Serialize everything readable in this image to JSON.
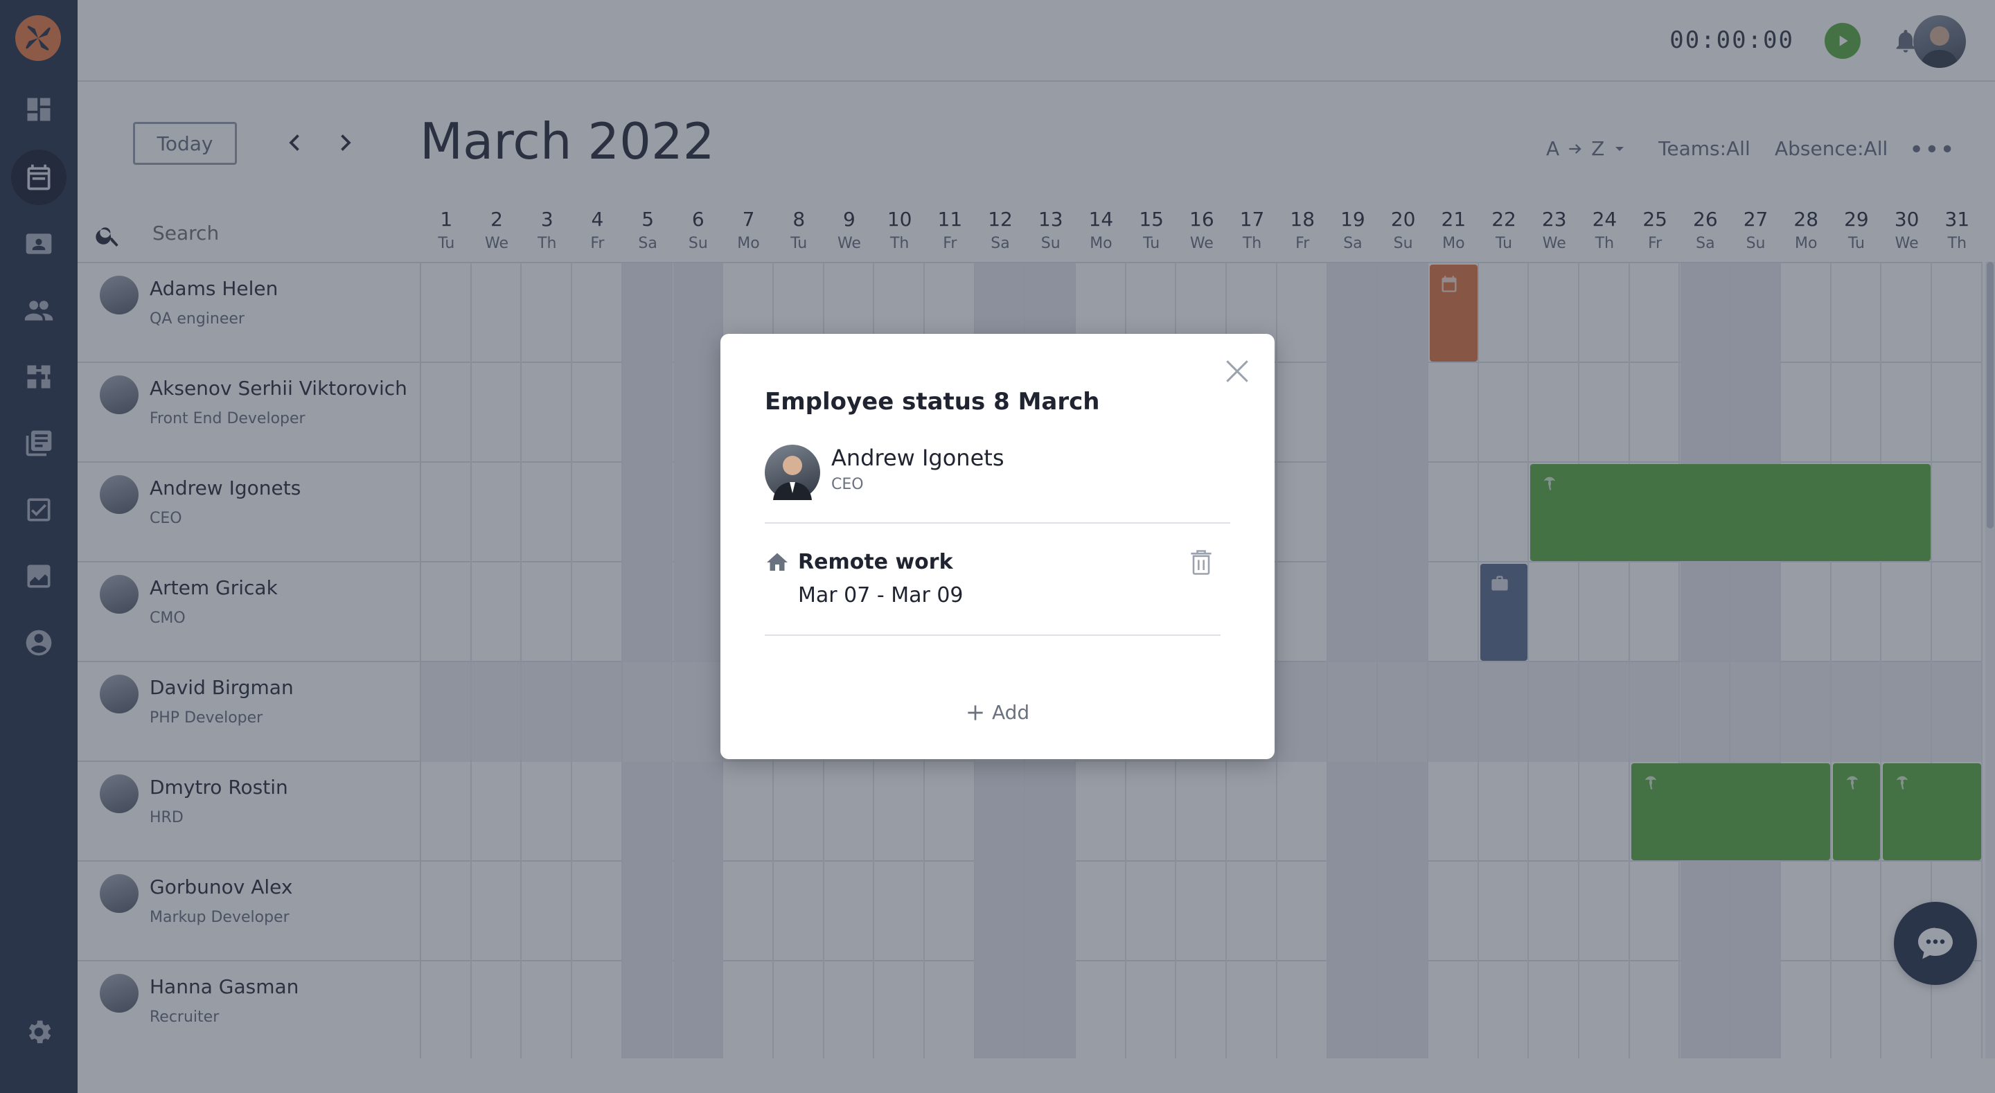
{
  "header": {
    "timer": "00:00:00"
  },
  "toolbar": {
    "today_label": "Today",
    "prev_symbol": "‹",
    "next_symbol": "›",
    "month_title": "March 2022",
    "sort_from": "A",
    "sort_to": "Z",
    "teams_filter": "Teams:All",
    "absence_filter": "Absence:All",
    "more_symbol": "•••"
  },
  "search": {
    "placeholder": "Search"
  },
  "days": [
    {
      "num": "1",
      "dow": "Tu"
    },
    {
      "num": "2",
      "dow": "We"
    },
    {
      "num": "3",
      "dow": "Th"
    },
    {
      "num": "4",
      "dow": "Fr"
    },
    {
      "num": "5",
      "dow": "Sa"
    },
    {
      "num": "6",
      "dow": "Su"
    },
    {
      "num": "7",
      "dow": "Mo"
    },
    {
      "num": "8",
      "dow": "Tu"
    },
    {
      "num": "9",
      "dow": "We"
    },
    {
      "num": "10",
      "dow": "Th"
    },
    {
      "num": "11",
      "dow": "Fr"
    },
    {
      "num": "12",
      "dow": "Sa"
    },
    {
      "num": "13",
      "dow": "Su"
    },
    {
      "num": "14",
      "dow": "Mo"
    },
    {
      "num": "15",
      "dow": "Tu"
    },
    {
      "num": "16",
      "dow": "We"
    },
    {
      "num": "17",
      "dow": "Th"
    },
    {
      "num": "18",
      "dow": "Fr"
    },
    {
      "num": "19",
      "dow": "Sa"
    },
    {
      "num": "20",
      "dow": "Su"
    },
    {
      "num": "21",
      "dow": "Mo"
    },
    {
      "num": "22",
      "dow": "Tu"
    },
    {
      "num": "23",
      "dow": "We"
    },
    {
      "num": "24",
      "dow": "Th"
    },
    {
      "num": "25",
      "dow": "Fr"
    },
    {
      "num": "26",
      "dow": "Sa"
    },
    {
      "num": "27",
      "dow": "Su"
    },
    {
      "num": "28",
      "dow": "Mo"
    },
    {
      "num": "29",
      "dow": "Tu"
    },
    {
      "num": "30",
      "dow": "We"
    },
    {
      "num": "31",
      "dow": "Th"
    }
  ],
  "employees": [
    {
      "name": "Adams Helen",
      "role": "QA engineer"
    },
    {
      "name": "Aksenov Serhii Viktorovich",
      "role": "Front End Developer"
    },
    {
      "name": "Andrew Igonets",
      "role": "CEO"
    },
    {
      "name": "Artem Gricak",
      "role": "CMO"
    },
    {
      "name": "David Birgman",
      "role": "PHP Developer"
    },
    {
      "name": "Dmytro Rostin",
      "role": "HRD"
    },
    {
      "name": "Gorbunov Alex",
      "role": "Markup Developer"
    },
    {
      "name": "Hanna Gasman",
      "role": "Recruiter"
    }
  ],
  "events": [
    {
      "row": 0,
      "start": 21,
      "end": 21,
      "color": "#e07a47",
      "icon": "calendar-icon"
    },
    {
      "row": 2,
      "start": 23,
      "end": 30,
      "color": "#5fae47",
      "icon": "palm-icon"
    },
    {
      "row": 3,
      "start": 22,
      "end": 22,
      "color": "#5e6f90",
      "icon": "briefcase-icon"
    },
    {
      "row": 5,
      "start": 25,
      "end": 28,
      "color": "#5fae47",
      "icon": "palm-icon"
    },
    {
      "row": 5,
      "start": 29,
      "end": 29,
      "color": "#5fae47",
      "icon": "palm-icon"
    },
    {
      "row": 5,
      "start": 30,
      "end": 31,
      "color": "#5fae47",
      "icon": "palm-icon"
    }
  ],
  "modal": {
    "title": "Employee status 8 March",
    "employee_name": "Andrew Igonets",
    "employee_role": "CEO",
    "status_type": "Remote work",
    "status_dates": "Mar 07 - Mar 09",
    "add_label": "Add"
  },
  "colors": {
    "accent_green": "#5fae47",
    "accent_orange": "#e07a47",
    "sidebar_bg": "#2e3a50"
  }
}
